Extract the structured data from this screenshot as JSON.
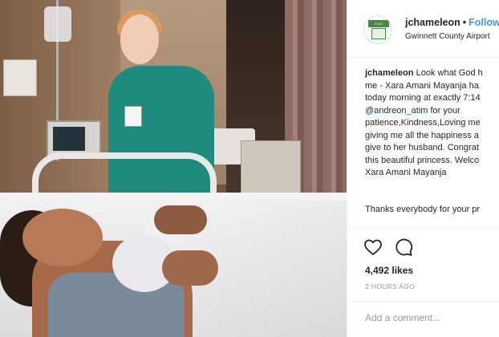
{
  "post": {
    "photo_alt": "Hospital room photo",
    "header": {
      "username": "jchameleon",
      "separator": "•",
      "follow_label": "Follow",
      "location": "Gwinnett County Airport"
    },
    "avatar": {
      "logo_text": "PLAY WITH THE CHAMPIONS"
    },
    "caption": {
      "author": "jchameleon",
      "line1_text": "Look what God h",
      "line2": "me - Xara Amani Mayanja ha",
      "line3": "today morning at exactly 7:14",
      "mention": "@andreon_atim",
      "line4_rest": "for your",
      "line5": "patience,Kindness,Loving me",
      "line6": "giving me all the happiness a",
      "line7": "give to her husband. Congrat",
      "line8": "this beautiful princess. Welco",
      "line9": "Xara Amani Mayanja"
    },
    "thanks": "Thanks everybody for your pr",
    "likes": "4,492 likes",
    "time_ago": "2 HOURS AGO",
    "comment_placeholder": "Add a comment...",
    "icons": {
      "like": "heart-icon",
      "comment": "comment-bubble-icon"
    },
    "colors": {
      "link_blue": "#3897f0",
      "mention_blue": "#003569",
      "muted_gray": "#999999",
      "border": "#efefef"
    }
  }
}
